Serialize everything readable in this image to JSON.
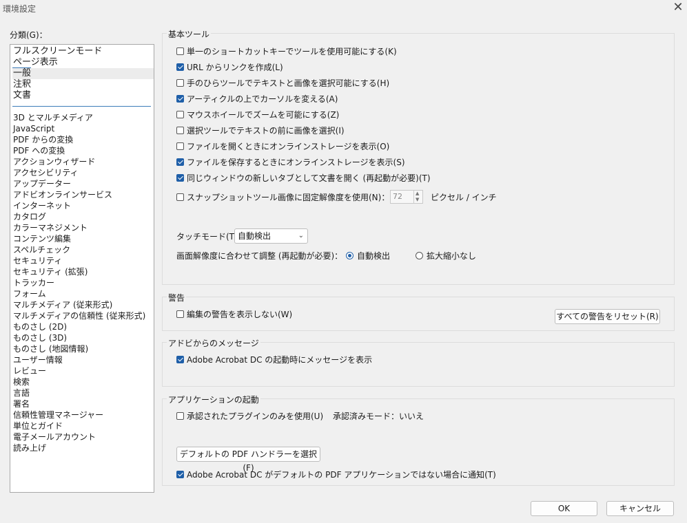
{
  "window": {
    "title": "環境設定",
    "close_glyph": "✕"
  },
  "category": {
    "label": "分類(G)：",
    "top_items": [
      "フルスクリーンモード",
      "ページ表示",
      "一般",
      "注釈",
      "文書"
    ],
    "items": [
      "3D とマルチメディア",
      "JavaScript",
      "PDF からの変換",
      "PDF への変換",
      "アクションウィザード",
      "アクセシビリティ",
      "アップデーター",
      "アドビオンラインサービス",
      "インターネット",
      "カタログ",
      "カラーマネジメント",
      "コンテンツ編集",
      "スペルチェック",
      "セキュリティ",
      "セキュリティ (拡張)",
      "トラッカー",
      "フォーム",
      "マルチメディア (従来形式)",
      "マルチメディアの信頼性 (従来形式)",
      "ものさし (2D)",
      "ものさし (3D)",
      "ものさし (地図情報)",
      "ユーザー情報",
      "レビュー",
      "検索",
      "言語",
      "署名",
      "信頼性管理マネージャー",
      "単位とガイド",
      "電子メールアカウント",
      "読み上げ"
    ]
  },
  "basic_tools": {
    "title": "基本ツール",
    "options": [
      {
        "label": "単一のショートカットキーでツールを使用可能にする(K)",
        "checked": false
      },
      {
        "label": "URL からリンクを作成(L)",
        "checked": true
      },
      {
        "label": "手のひらツールでテキストと画像を選択可能にする(H)",
        "checked": false
      },
      {
        "label": "アーティクルの上でカーソルを変える(A)",
        "checked": true
      },
      {
        "label": "マウスホイールでズームを可能にする(Z)",
        "checked": false
      },
      {
        "label": "選択ツールでテキストの前に画像を選択(I)",
        "checked": false
      },
      {
        "label": "ファイルを開くときにオンラインストレージを表示(O)",
        "checked": false
      },
      {
        "label": "ファイルを保存するときにオンラインストレージを表示(S)",
        "checked": true
      },
      {
        "label": "同じウィンドウの新しいタブとして文書を開く (再起動が必要)(T)",
        "checked": true
      }
    ],
    "snapshot_label": "スナップショットツール画像に固定解像度を使用(N)：",
    "snapshot_value": "72",
    "snapshot_unit": "ピクセル / インチ",
    "touch_label": "タッチモード(T)：",
    "touch_value": "自動検出",
    "scale_label": "画面解像度に合わせて調整 (再起動が必要)：",
    "scale_auto": "自動検出",
    "scale_none": "拡大縮小なし"
  },
  "warnings": {
    "title": "警告",
    "option": "編集の警告を表示しない(W)",
    "reset_button": "すべての警告をリセット(R)"
  },
  "messages": {
    "title": "アドビからのメッセージ",
    "option": "Adobe Acrobat DC の起動時にメッセージを表示"
  },
  "startup": {
    "title": "アプリケーションの起動",
    "plugins_option": "承認されたプラグインのみを使用(U)",
    "approved_mode_label": "承認済みモード：",
    "approved_mode_value": "いいえ",
    "default_handler_button": "デフォルトの PDF ハンドラーを選択(F)",
    "notify_option": "Adobe Acrobat DC がデフォルトの PDF アプリケーションではない場合に通知(T)"
  },
  "footer": {
    "ok": "OK",
    "cancel": "キャンセル"
  },
  "colors": {
    "accent": "#1f5fa8",
    "underline": "#3b7bb8",
    "background": "#f0f0f0"
  }
}
